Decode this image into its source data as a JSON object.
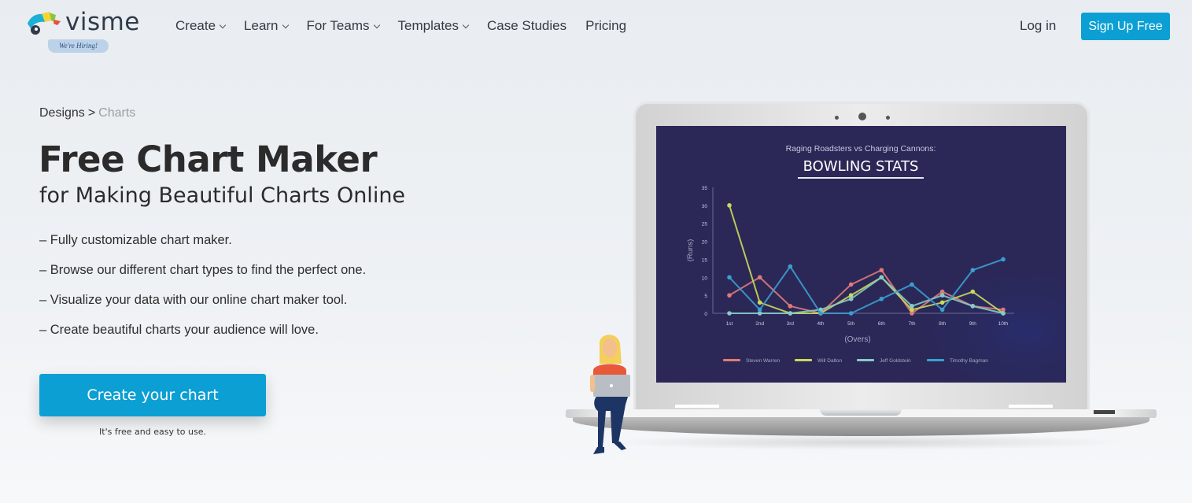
{
  "brand": {
    "name": "visme",
    "hiring_badge": "We're Hiring!",
    "colors": {
      "primary": "#0c9fd4",
      "text": "#2b2b2b",
      "screen_bg": "#2b2858"
    }
  },
  "nav": {
    "items": [
      {
        "label": "Create",
        "dropdown": true
      },
      {
        "label": "Learn",
        "dropdown": true
      },
      {
        "label": "For Teams",
        "dropdown": true
      },
      {
        "label": "Templates",
        "dropdown": true
      },
      {
        "label": "Case Studies",
        "dropdown": false
      },
      {
        "label": "Pricing",
        "dropdown": false
      }
    ],
    "login": "Log in",
    "signup": "Sign Up Free"
  },
  "hero": {
    "breadcrumb": {
      "parent": "Designs",
      "separator": ">",
      "current": "Charts"
    },
    "title": "Free Chart Maker",
    "subtitle": "for Making Beautiful Charts Online",
    "features": [
      "– Fully customizable chart maker.",
      "– Browse our different chart types to find the perfect one.",
      "– Visualize your data with our online chart maker tool.",
      "– Create beautiful charts your audience will love."
    ],
    "cta": "Create your chart",
    "cta_note": "It's free and easy to use."
  },
  "chart_data": {
    "type": "line",
    "title": "BOWLING STATS",
    "subtitle": "Raging Roadsters vs Charging Cannons:",
    "xlabel": "(Overs)",
    "ylabel": "(Runs)",
    "ylim": [
      0,
      35
    ],
    "yticks": [
      0,
      5,
      10,
      15,
      20,
      25,
      30,
      35
    ],
    "categories": [
      "1st",
      "2nd",
      "3rd",
      "4th",
      "5th",
      "6th",
      "7th",
      "8th",
      "9th",
      "10th"
    ],
    "legend_position": "bottom",
    "grid": false,
    "series": [
      {
        "name": "Steven Warren",
        "color": "#e07a78",
        "values": [
          5,
          10,
          2,
          0,
          8,
          12,
          0,
          6,
          2,
          1
        ]
      },
      {
        "name": "Will Dalton",
        "color": "#c9d95a",
        "values": [
          30,
          3,
          0,
          0,
          5,
          10,
          1,
          3,
          6,
          0
        ]
      },
      {
        "name": "Jeff Goldstein",
        "color": "#86cbc6",
        "values": [
          0,
          0,
          0,
          1,
          4,
          10,
          2,
          5,
          2,
          0
        ]
      },
      {
        "name": "Timothy Bagman",
        "color": "#3a9fd0",
        "values": [
          10,
          1,
          13,
          0,
          0,
          4,
          8,
          1,
          12,
          15
        ]
      }
    ]
  }
}
